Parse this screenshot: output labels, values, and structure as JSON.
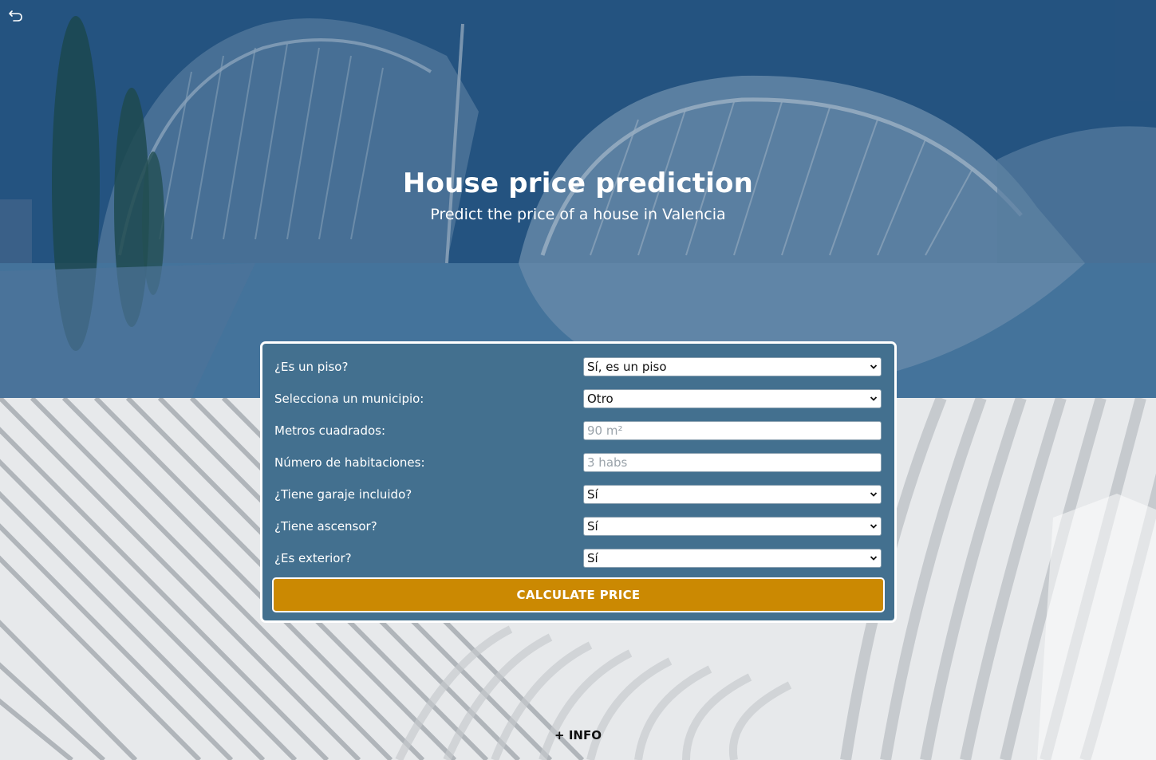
{
  "header": {
    "title": "House price prediction",
    "subtitle": "Predict the price of a house in Valencia"
  },
  "nav": {
    "back_icon": "undo-arrow-icon"
  },
  "form": {
    "fields": [
      {
        "label": "¿Es un piso?",
        "type": "select",
        "value": "Sí, es un piso",
        "placeholder": ""
      },
      {
        "label": "Selecciona un municipio:",
        "type": "select",
        "value": "Otro",
        "placeholder": ""
      },
      {
        "label": "Metros cuadrados:",
        "type": "input",
        "value": "",
        "placeholder": "90 m²"
      },
      {
        "label": "Número de habitaciones:",
        "type": "input",
        "value": "",
        "placeholder": "3 habs"
      },
      {
        "label": "¿Tiene garaje incluido?",
        "type": "select",
        "value": "Sí",
        "placeholder": ""
      },
      {
        "label": "¿Tiene ascensor?",
        "type": "select",
        "value": "Sí",
        "placeholder": ""
      },
      {
        "label": "¿Es exterior?",
        "type": "select",
        "value": "Sí",
        "placeholder": ""
      }
    ],
    "submit_label": "CALCULATE PRICE"
  },
  "footer": {
    "info_label": "+ INFO"
  },
  "colors": {
    "card_bg": "#43708f",
    "button_bg": "#cb8902",
    "hero_tint": "#2b5a87"
  }
}
